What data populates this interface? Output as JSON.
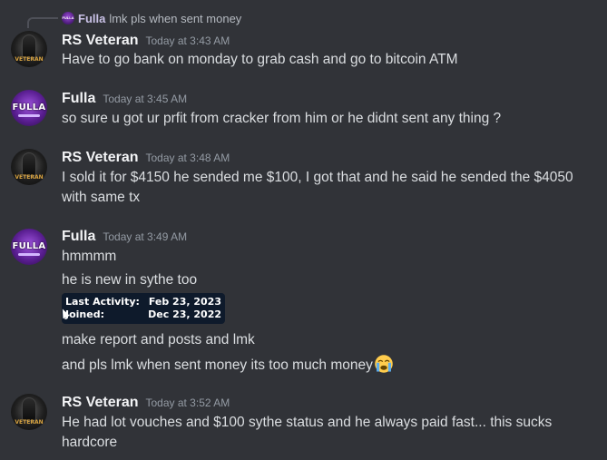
{
  "reply": {
    "username": "Fulla",
    "avatar_text": "FULLA",
    "text": "lmk pls when sent money"
  },
  "messages": [
    {
      "username": "RS Veteran",
      "timestamp": "Today at 3:43 AM",
      "avatar": "VETERAN",
      "lines": [
        "Have to go bank on monday to grab cash and go to bitcoin ATM"
      ]
    },
    {
      "username": "Fulla",
      "timestamp": "Today at 3:45 AM",
      "avatar": "FULLA",
      "lines": [
        "so sure u got ur prfit from cracker from him or he didnt sent any thing ?"
      ]
    },
    {
      "username": "RS Veteran",
      "timestamp": "Today at 3:48 AM",
      "avatar": "VETERAN",
      "lines": [
        "I sold it for $4150 he sended me $100, I got that and he said he sended the $4050",
        "with same tx"
      ]
    },
    {
      "username": "Fulla",
      "timestamp": "Today at 3:49 AM",
      "avatar": "FULLA",
      "lines": [
        "hmmmm",
        "he is new in sythe too",
        "make report and posts and lmk",
        "and pls lmk when sent money its too much money"
      ]
    },
    {
      "username": "RS Veteran",
      "timestamp": "Today at 3:52 AM",
      "avatar": "VETERAN",
      "lines": [
        "He had lot vouches and $100 sythe status and he always paid fast... this sucks",
        "hardcore"
      ]
    }
  ],
  "attachment": {
    "rows": [
      {
        "label": "Last Activity:",
        "value": "Feb 23, 2023"
      },
      {
        "label": "Joined:",
        "value": "Dec 23, 2022"
      }
    ]
  },
  "icons": {
    "crying_emoji": "loudly-crying-face-icon"
  },
  "colors": {
    "background": "#313338",
    "username": "#f2f3f5",
    "timestamp": "#949ba4",
    "text": "#dbdee1"
  }
}
